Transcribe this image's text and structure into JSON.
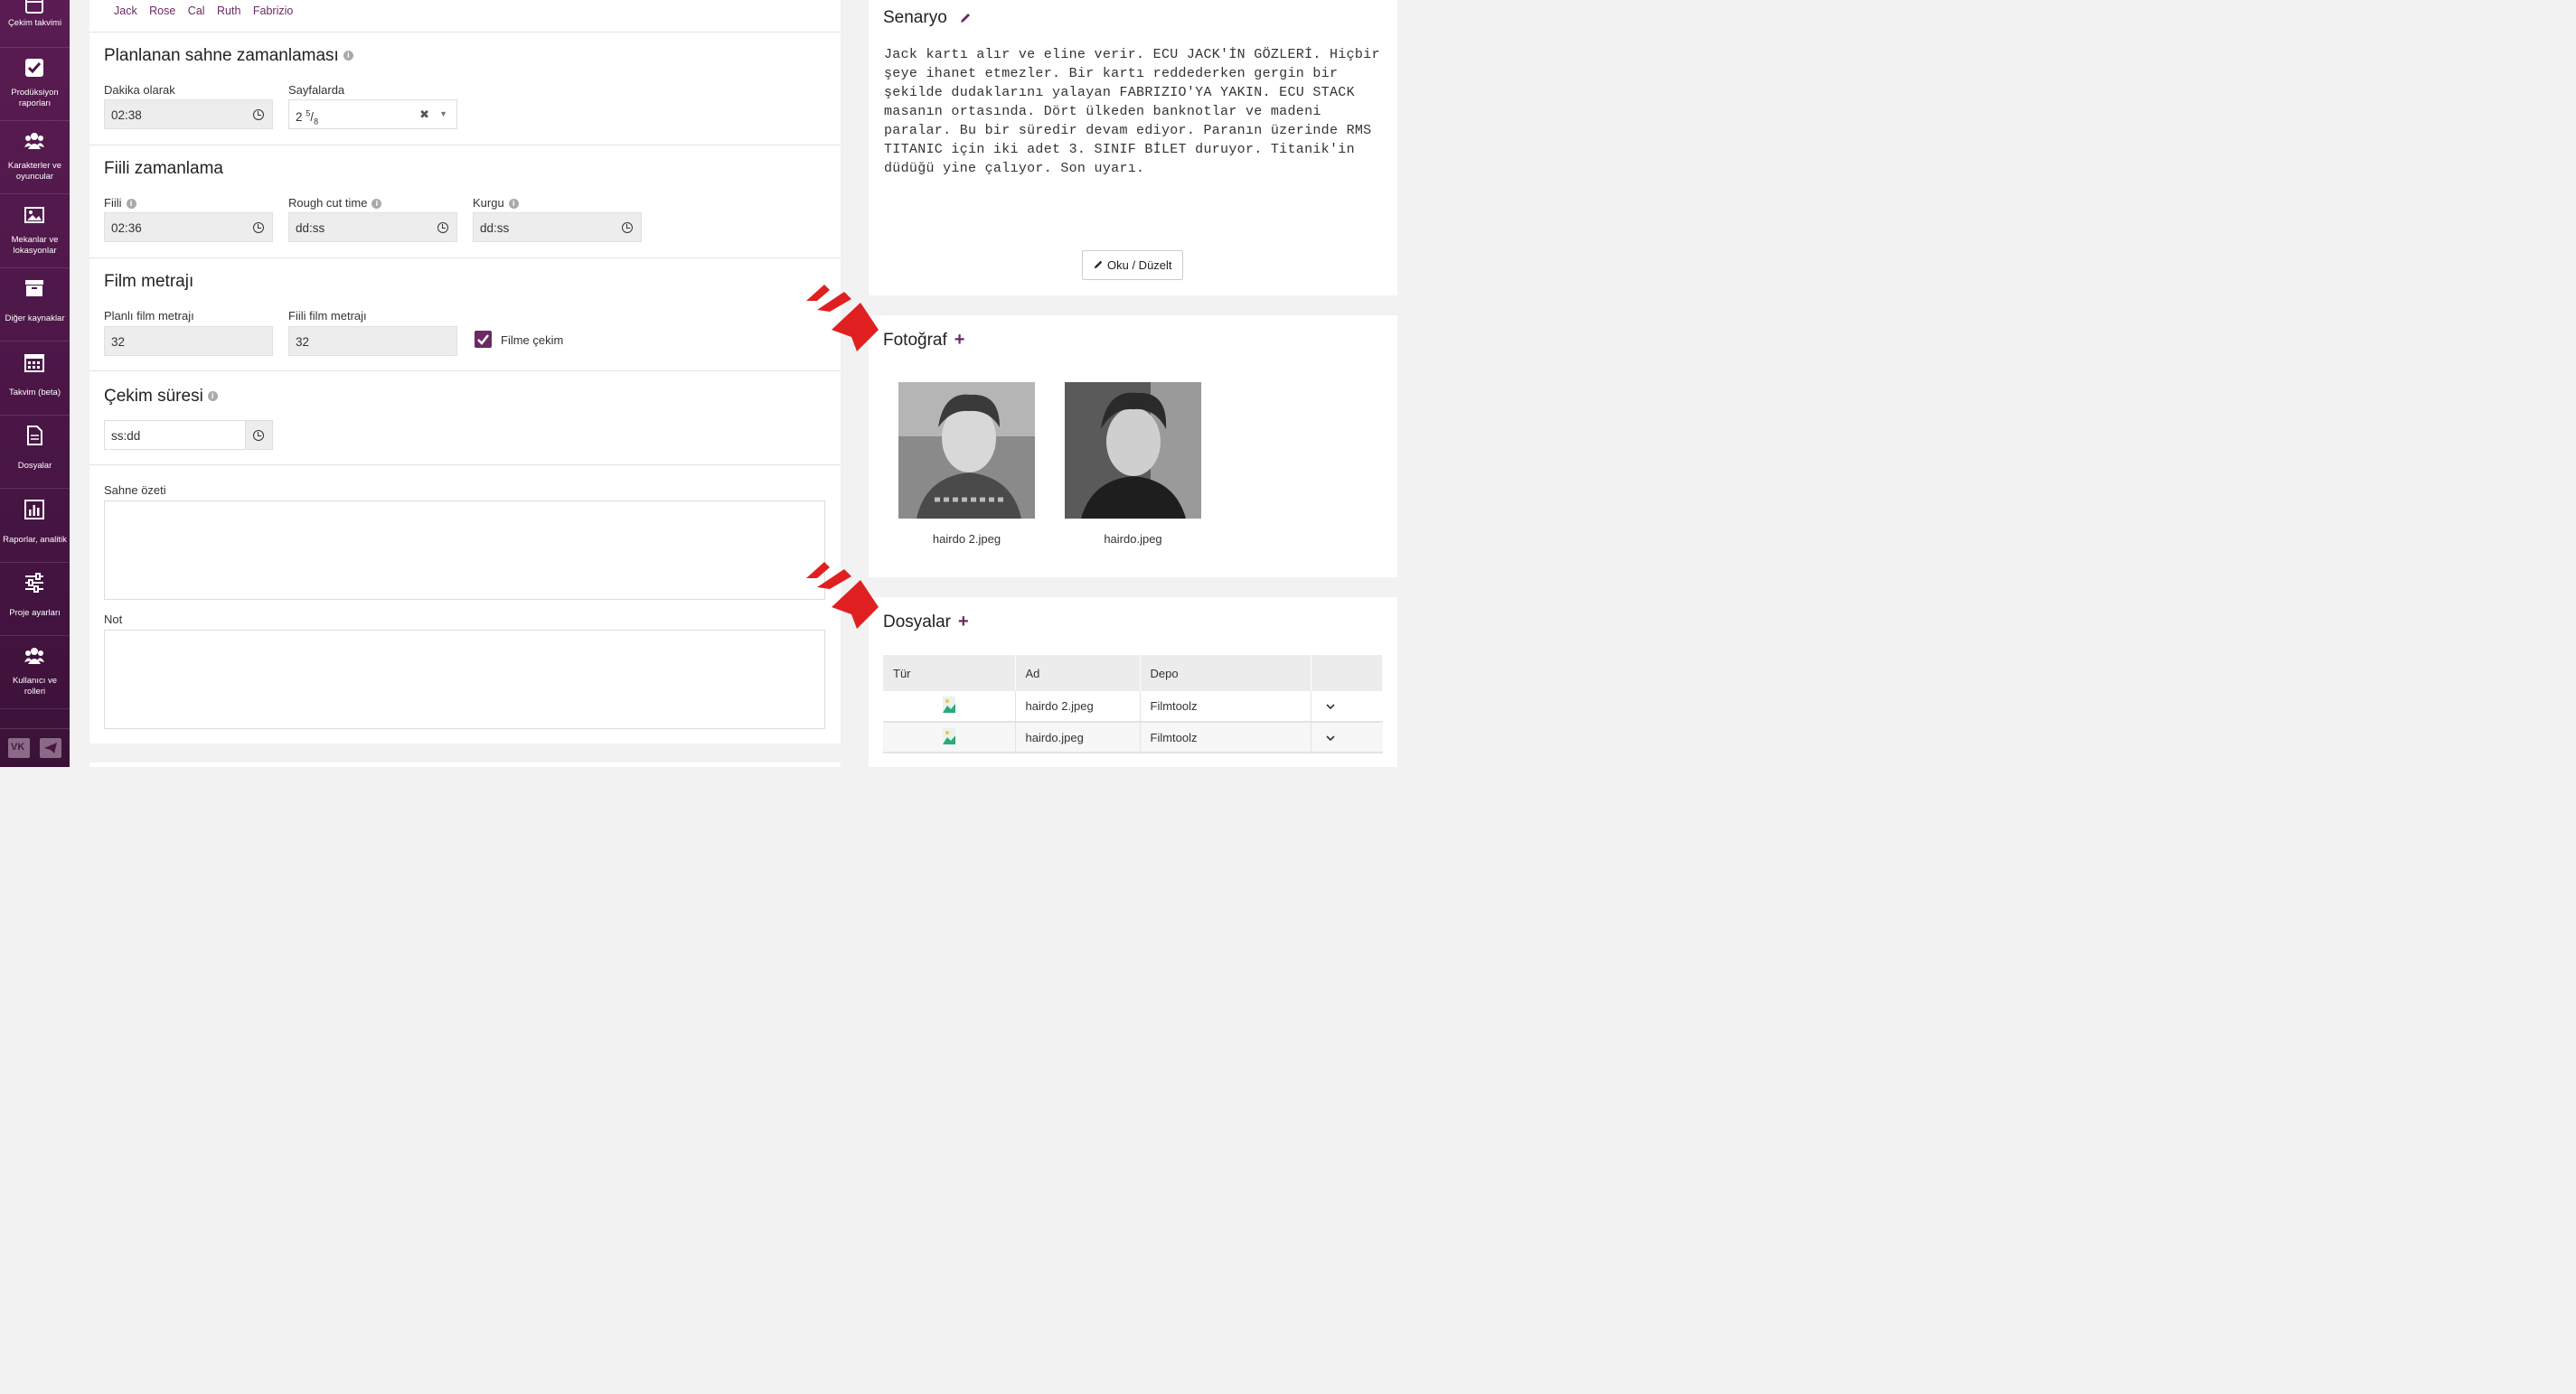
{
  "sidebar": {
    "items": [
      {
        "label": "Çekim takvimi",
        "icon": "calendar-icon"
      },
      {
        "label": "Prodüksiyon raporları",
        "icon": "checkbox-icon"
      },
      {
        "label": "Karakterler ve oyuncular",
        "icon": "users-icon"
      },
      {
        "label": "Mekanlar ve lokasyonlar",
        "icon": "image-icon"
      },
      {
        "label": "Diğer kaynaklar",
        "icon": "archive-icon"
      },
      {
        "label": "Takvim (beta)",
        "icon": "calendar-grid-icon"
      },
      {
        "label": "Dosyalar",
        "icon": "file-icon"
      },
      {
        "label": "Raporlar, analitik",
        "icon": "bar-chart-icon"
      },
      {
        "label": "Proje ayarları",
        "icon": "sliders-icon"
      },
      {
        "label": "Kullanıcı ve rolleri",
        "icon": "user-group-icon"
      }
    ],
    "social": [
      "vk-icon",
      "telegram-icon"
    ]
  },
  "characters": [
    "Jack",
    "Rose",
    "Cal",
    "Ruth",
    "Fabrizio"
  ],
  "planned": {
    "title": "Planlanan sahne zamanlaması",
    "minutes_label": "Dakika olarak",
    "minutes_value": "02:38",
    "pages_label": "Sayfalarda",
    "pages_whole": "2",
    "pages_num": "5",
    "pages_den": "8"
  },
  "actual": {
    "title": "Fiili zamanlama",
    "actual_label": "Fiili",
    "actual_value": "02:36",
    "rough_label": "Rough cut time",
    "rough_value": "dd:ss",
    "edit_label": "Kurgu",
    "edit_value": "dd:ss"
  },
  "footage": {
    "title": "Film metrajı",
    "planned_label": "Planlı film metrajı",
    "planned_value": "32",
    "actual_label": "Fiili film metrajı",
    "actual_value": "32",
    "checkbox_label": "Filme çekim",
    "checked": true
  },
  "shoot": {
    "title": "Çekim süresi",
    "value": "ss:dd"
  },
  "summary_label": "Sahne özeti",
  "note_label": "Not",
  "script": {
    "title": "Senaryo",
    "text": "Jack kartı alır ve eline verir. ECU JACK'İN GÖZLERİ. Hiçbir şeye ihanet etmezler. Bir kartı reddederken gergin bir şekilde dudaklarını yalayan FABRIZIO'YA YAKIN. ECU STACK masanın ortasında. Dört ülkeden banknotlar ve madeni paralar. Bu bir süredir devam ediyor. Paranın üzerinde RMS TITANIC için iki adet 3. SINIF BİLET duruyor. Titanik'in düdüğü yine çalıyor. Son uyarı.",
    "button": "Oku / Düzelt"
  },
  "photos": {
    "title": "Fotoğraf",
    "items": [
      {
        "caption": "hairdo 2.jpeg"
      },
      {
        "caption": "hairdo.jpeg"
      }
    ]
  },
  "files": {
    "title": "Dosyalar",
    "headers": [
      "Tür",
      "Ad",
      "Depo",
      ""
    ],
    "rows": [
      {
        "name": "hairdo 2.jpeg",
        "storage": "Filmtoolz"
      },
      {
        "name": "hairdo.jpeg",
        "storage": "Filmtoolz"
      }
    ]
  },
  "colors": {
    "accent": "#6a2a63",
    "sidebar": "#4a1646",
    "arrow": "#e02020"
  }
}
